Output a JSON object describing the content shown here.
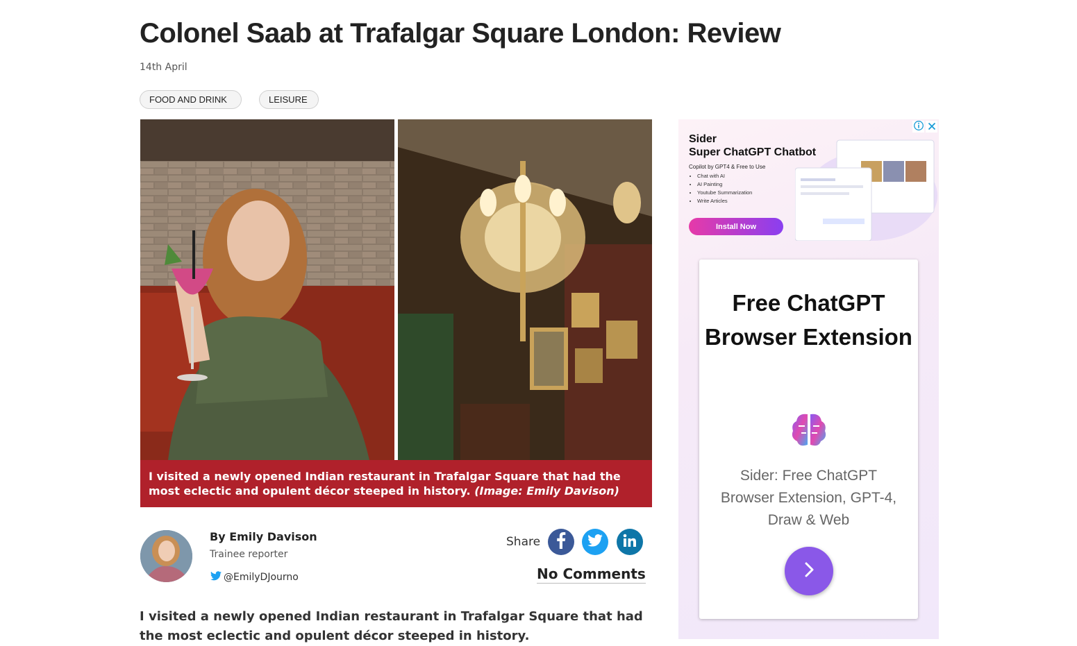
{
  "article": {
    "title": "Colonel Saab at Trafalgar Square London: Review",
    "date": "14th April",
    "tags": [
      "FOOD AND DRINK",
      "LEISURE"
    ],
    "caption": "I visited a newly opened Indian restaurant in Trafalgar Square that had the most eclectic and opulent décor steeped in history.",
    "caption_credit": "(Image: Emily Davison)",
    "lead": "I visited a newly opened Indian restaurant in Trafalgar Square that had the most eclectic and opulent décor steeped in history."
  },
  "author": {
    "byline": "By Emily Davison",
    "role": "Trainee reporter",
    "twitter": "@EmilyDJourno"
  },
  "share": {
    "label": "Share",
    "icons": [
      "facebook-icon",
      "twitter-icon",
      "linkedin-icon"
    ],
    "comments_label": "No Comments"
  },
  "ad": {
    "brand_line1": "Sider",
    "brand_line2": "Super ChatGPT Chatbot",
    "subtitle": "Copilot by GPT4 & Free to Use",
    "features": [
      "Chat with AI",
      "AI Painting",
      "Youtube Summarization",
      "Write Articles"
    ],
    "install_label": "Install Now",
    "card_title": "Free ChatGPT Browser Extension",
    "card_desc": "Sider: Free ChatGPT Browser Extension, GPT-4, Draw & Web"
  },
  "colors": {
    "caption_bg": "#b0212b",
    "facebook": "#3b5998",
    "twitter": "#1da1f2",
    "linkedin": "#0e76a8",
    "ad_button": "#8a58e8"
  }
}
